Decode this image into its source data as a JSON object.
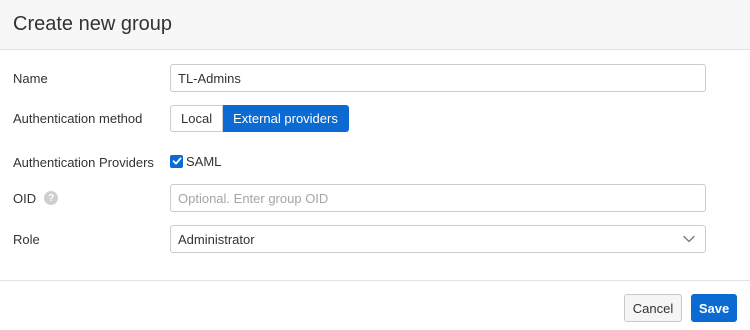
{
  "dialog": {
    "title": "Create new group"
  },
  "form": {
    "name": {
      "label": "Name",
      "value": "TL-Admins"
    },
    "auth_method": {
      "label": "Authentication method",
      "options": [
        "Local",
        "External providers"
      ],
      "selected": "External providers"
    },
    "auth_providers": {
      "label": "Authentication Providers",
      "saml_label": "SAML",
      "saml_checked": true
    },
    "oid": {
      "label": "OID",
      "help_glyph": "?",
      "placeholder": "Optional. Enter group OID",
      "value": ""
    },
    "role": {
      "label": "Role",
      "selected": "Administrator"
    }
  },
  "footer": {
    "cancel_label": "Cancel",
    "save_label": "Save"
  },
  "icons": {
    "help": "help-icon",
    "checkmark": "checkmark-icon",
    "chevron": "chevron-down-icon"
  },
  "colors": {
    "accent": "#0b6bd2",
    "header_bg": "#f7f7f7",
    "border": "#cccccc"
  }
}
